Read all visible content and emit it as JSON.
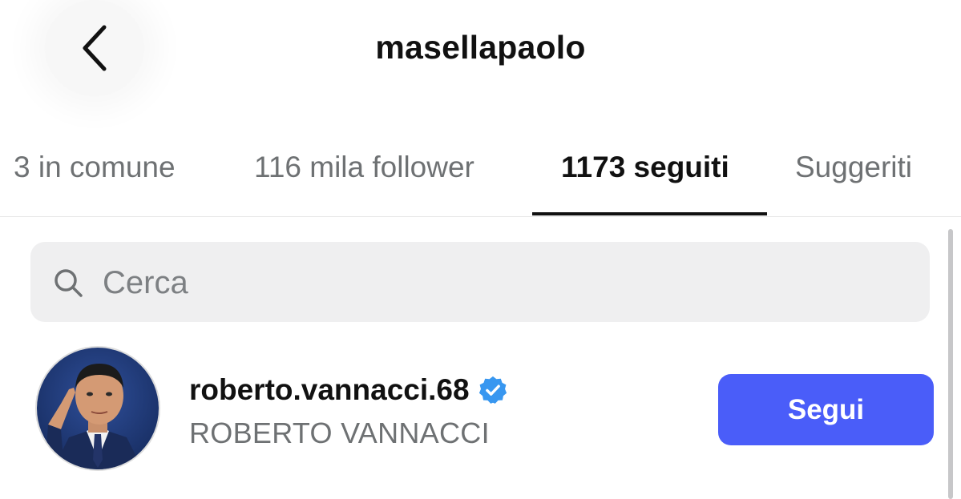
{
  "header": {
    "title": "masellapaolo",
    "back_icon": "chevron-left-icon"
  },
  "tabs": [
    {
      "label": "3 in comune",
      "active": false
    },
    {
      "label": "116 mila follower",
      "active": false
    },
    {
      "label": "1173 seguiti",
      "active": true
    },
    {
      "label": "Suggeriti",
      "active": false
    }
  ],
  "search": {
    "placeholder": "Cerca",
    "value": "",
    "icon": "search-icon"
  },
  "list": {
    "items": [
      {
        "username": "roberto.vannacci.68",
        "full_name": "ROBERTO VANNACCI",
        "verified": true,
        "follow_label": "Segui"
      }
    ]
  },
  "colors": {
    "accent": "#4a5df9",
    "verified": "#3897f0",
    "text_primary": "#111111",
    "text_secondary": "#6e7173",
    "search_bg": "#efeff0"
  }
}
